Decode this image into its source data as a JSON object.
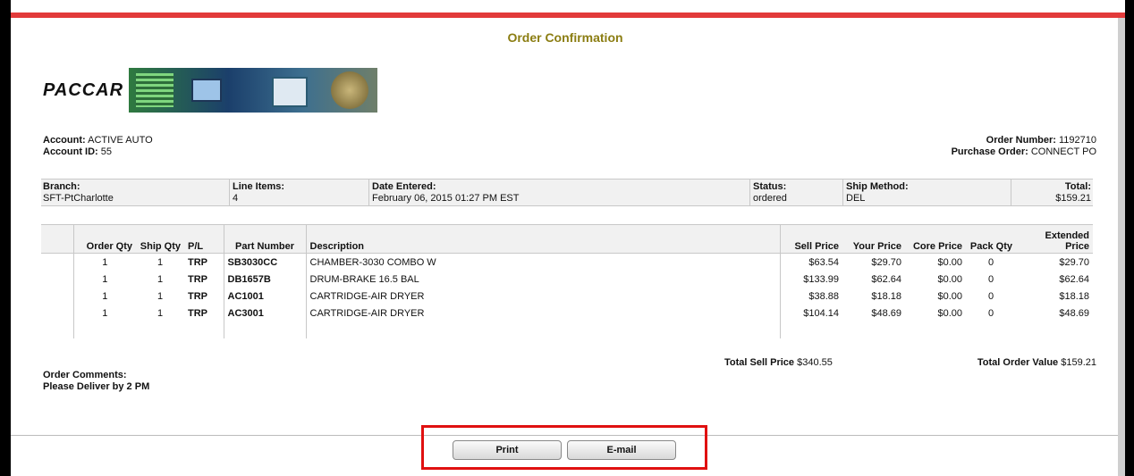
{
  "page": {
    "title": "Order Confirmation",
    "brand": "PACCAR"
  },
  "account": {
    "account_label": "Account:",
    "account_value": "ACTIVE AUTO",
    "id_label": "Account ID:",
    "id_value": "55"
  },
  "order": {
    "number_label": "Order Number:",
    "number_value": "1192710",
    "po_label": "Purchase Order:",
    "po_value": "CONNECT PO"
  },
  "summary": {
    "branch_label": "Branch:",
    "branch_value": "SFT-PtCharlotte",
    "line_items_label": "Line Items:",
    "line_items_value": "4",
    "date_label": "Date Entered:",
    "date_value": "February 06, 2015 01:27 PM EST",
    "status_label": "Status:",
    "status_value": "ordered",
    "ship_label": "Ship Method:",
    "ship_value": "DEL",
    "total_label": "Total:",
    "total_value": "$159.21"
  },
  "table": {
    "headers": [
      "Order Qty",
      "Ship Qty",
      "P/L",
      "Part Number",
      "Description",
      "Sell Price",
      "Your Price",
      "Core Price",
      "Pack Qty",
      "Extended",
      "Price"
    ],
    "rows": [
      [
        "1",
        "1",
        "TRP",
        "SB3030CC",
        "CHAMBER-3030 COMBO W",
        "$63.54",
        "$29.70",
        "$0.00",
        "0",
        "$29.70"
      ],
      [
        "1",
        "1",
        "TRP",
        "DB1657B",
        "DRUM-BRAKE 16.5 BAL",
        "$133.99",
        "$62.64",
        "$0.00",
        "0",
        "$62.64"
      ],
      [
        "1",
        "1",
        "TRP",
        "AC1001",
        "CARTRIDGE-AIR DRYER",
        "$38.88",
        "$18.18",
        "$0.00",
        "0",
        "$18.18"
      ],
      [
        "1",
        "1",
        "TRP",
        "AC3001",
        "CARTRIDGE-AIR DRYER",
        "$104.14",
        "$48.69",
        "$0.00",
        "0",
        "$48.69"
      ]
    ]
  },
  "totals": {
    "sell_label": "Total Sell Price",
    "sell_value": "$340.55",
    "value_label": "Total Order Value",
    "value_value": "$159.21"
  },
  "comments": {
    "label": "Order Comments:",
    "text": "Please Deliver by 2 PM"
  },
  "buttons": {
    "print": "Print",
    "email": "E-mail"
  },
  "colors": {
    "accent_red": "#e23a3a",
    "title_olive": "#8b7d12",
    "highlight_red": "#e01010"
  }
}
